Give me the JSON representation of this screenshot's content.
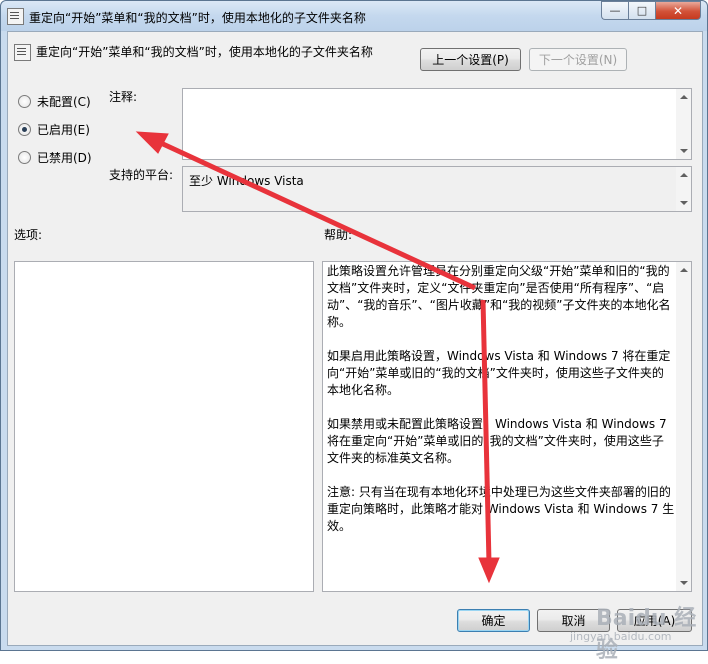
{
  "window": {
    "title": "重定向“开始”菜单和“我的文档”时，使用本地化的子文件夹名称",
    "minimize_glyph": "—",
    "maximize_glyph": "□",
    "close_glyph": "✕"
  },
  "header": {
    "policy_title": "重定向“开始”菜单和“我的文档”时，使用本地化的子文件夹名称",
    "prev_button": "上一个设置(P)",
    "next_button": "下一个设置(N)"
  },
  "state": {
    "options": [
      {
        "label": "未配置(C)",
        "checked": false
      },
      {
        "label": "已启用(E)",
        "checked": true
      },
      {
        "label": "已禁用(D)",
        "checked": false
      }
    ]
  },
  "fields": {
    "comment_label": "注释:",
    "comment_value": "",
    "platform_label": "支持的平台:",
    "platform_value": "至少 Windows Vista"
  },
  "sections": {
    "options_label": "选项:",
    "help_label": "帮助:"
  },
  "help": {
    "paragraphs": [
      "此策略设置允许管理员在分别重定向父级“开始”菜单和旧的“我的文档”文件夹时，定义“文件夹重定向”是否使用“所有程序”、“启动”、“我的音乐”、“图片收藏”和“我的视频”子文件夹的本地化名称。",
      "如果启用此策略设置，Windows Vista 和 Windows 7 将在重定向“开始”菜单或旧的“我的文档”文件夹时，使用这些子文件夹的本地化名称。",
      "如果禁用或未配置此策略设置，Windows Vista 和 Windows 7 将在重定向“开始”菜单或旧的“我的文档”文件夹时，使用这些子文件夹的标准英文名称。",
      "注意: 只有当在现有本地化环境中处理已为这些文件夹部署的旧的重定向策略时，此策略才能对 Windows Vista 和 Windows 7 生效。"
    ]
  },
  "footer": {
    "ok_button": "确定",
    "cancel_button": "取消",
    "apply_button": "应用(A)"
  },
  "watermark": {
    "brand": "Baidu 经验",
    "url": "jingyan.baidu.com"
  },
  "colors": {
    "annotation_arrow": "#e8333b",
    "window_frame": "#c9dbee",
    "dialog_background": "#f0f0f0"
  },
  "icons": [
    "policy-icon",
    "annotation-arrow"
  ]
}
